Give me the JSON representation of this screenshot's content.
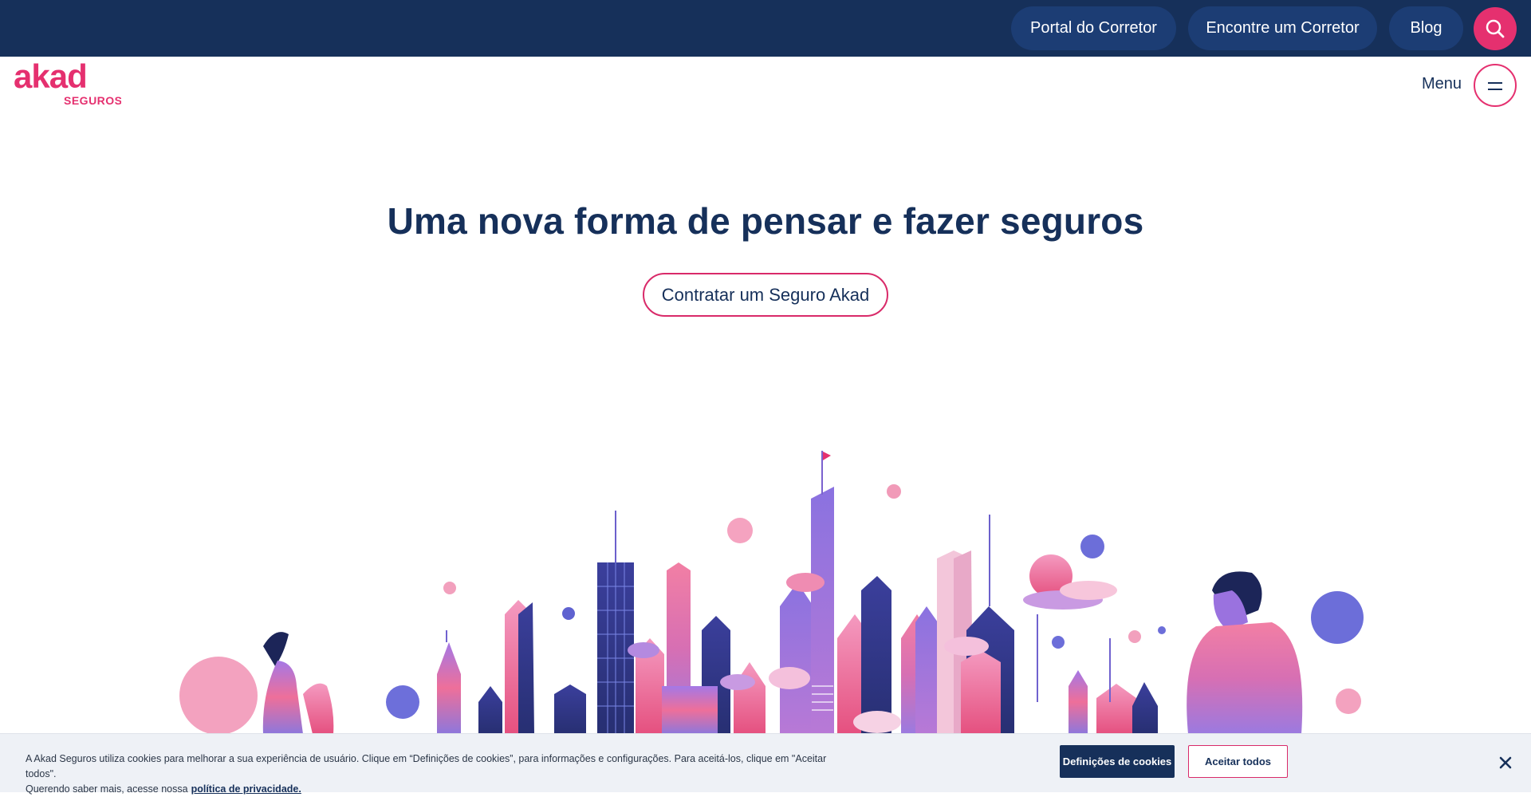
{
  "topbar": {
    "portal_label": "Portal do Corretor",
    "encontre_label": "Encontre um Corretor",
    "blog_label": "Blog",
    "search_icon": "search-icon"
  },
  "header": {
    "logo_main": "akad",
    "logo_sub": "SEGUROS",
    "menu_label": "Menu",
    "menu_icon": "hamburger-icon"
  },
  "hero": {
    "title_regular": "Uma nova forma de ",
    "title_bold": "pensar e fazer seguros",
    "cta_label": "Contratar um Seguro Akad"
  },
  "cookie": {
    "text_line1": "A Akad Seguros utiliza cookies para melhorar a sua experiência de usuário. Clique em “Definições de cookies”, para informações e configurações. Para aceitá-los, clique em \"Aceitar todos\".",
    "text_line2": "Querendo saber mais, acesse nossa",
    "policy_link": "política de privacidade.",
    "settings_label": "Definições de cookies",
    "accept_label": "Aceitar todos",
    "close_icon": "close-icon"
  },
  "colors": {
    "navy": "#16305a",
    "pill": "#1c3d74",
    "pink": "#e5306f",
    "purple": "#6e6edb"
  }
}
